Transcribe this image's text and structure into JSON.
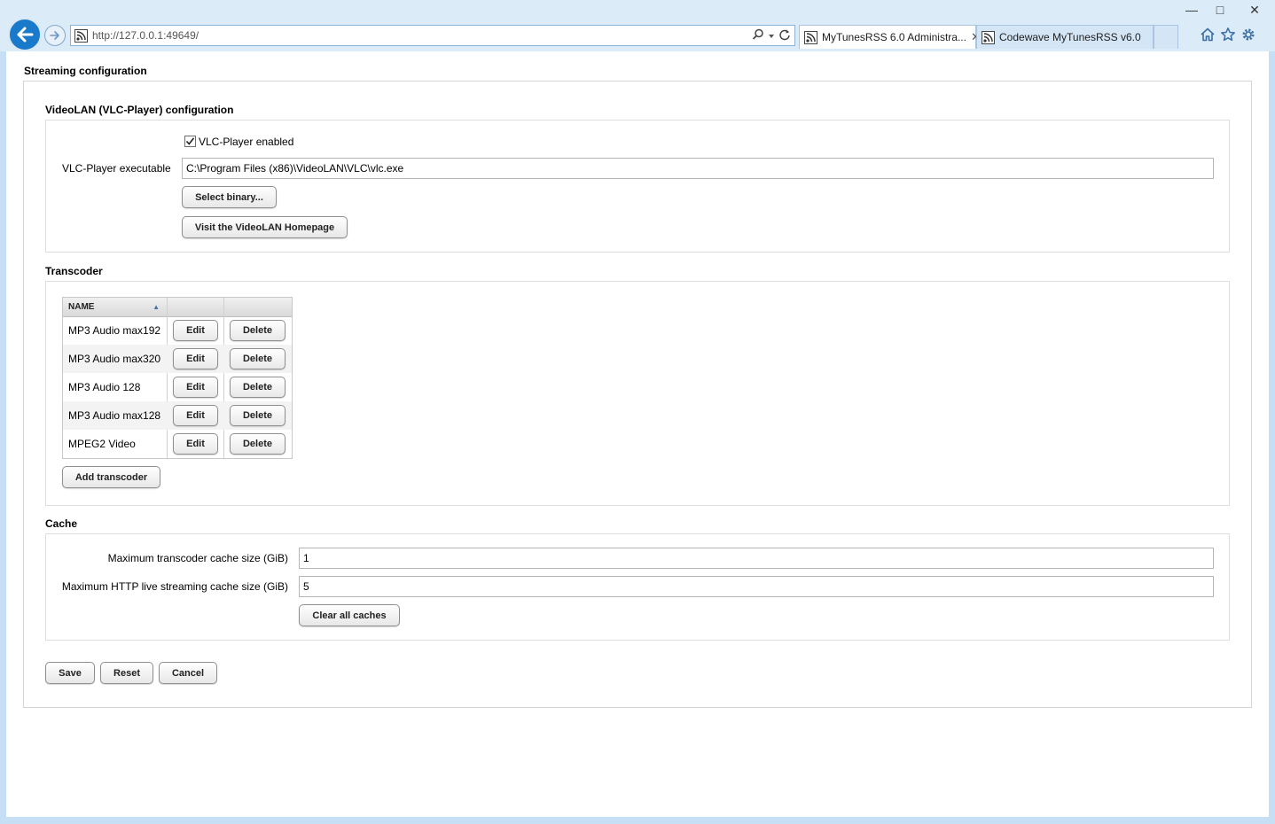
{
  "browser": {
    "url": "http://127.0.0.1:49649/",
    "tabs": [
      {
        "label": "MyTunesRSS 6.0 Administra...",
        "active": true
      },
      {
        "label": "Codewave MyTunesRSS v6.0",
        "active": false
      }
    ],
    "icons": [
      "back-arrow-icon",
      "forward-arrow-icon",
      "rss-favicon-icon",
      "search-icon",
      "dropdown-icon",
      "refresh-icon",
      "close-icon",
      "home-icon",
      "star-icon",
      "gear-icon",
      "minimize-icon",
      "maximize-icon",
      "window-close-icon"
    ]
  },
  "page": {
    "title": "Streaming configuration",
    "vlc": {
      "title": "VideoLAN (VLC-Player) configuration",
      "enabled_label": "VLC-Player enabled",
      "enabled": true,
      "executable_label": "VLC-Player executable",
      "executable_value": "C:\\Program Files (x86)\\VideoLAN\\VLC\\vlc.exe",
      "select_binary_label": "Select binary...",
      "visit_homepage_label": "Visit the VideoLAN Homepage"
    },
    "transcoder": {
      "title": "Transcoder",
      "columns": [
        "NAME",
        "",
        ""
      ],
      "sort_indicator": "▲",
      "rows": [
        {
          "name": "MP3 Audio max192",
          "edit": "Edit",
          "delete": "Delete"
        },
        {
          "name": "MP3 Audio max320",
          "edit": "Edit",
          "delete": "Delete"
        },
        {
          "name": "MP3 Audio 128",
          "edit": "Edit",
          "delete": "Delete"
        },
        {
          "name": "MP3 Audio max128",
          "edit": "Edit",
          "delete": "Delete"
        },
        {
          "name": "MPEG2 Video",
          "edit": "Edit",
          "delete": "Delete"
        }
      ],
      "add_label": "Add transcoder"
    },
    "cache": {
      "title": "Cache",
      "transcoder_cache_label": "Maximum transcoder cache size (GiB)",
      "transcoder_cache_value": "1",
      "hls_cache_label": "Maximum HTTP live streaming cache size (GiB)",
      "hls_cache_value": "5",
      "clear_label": "Clear all caches"
    },
    "actions": {
      "save": "Save",
      "reset": "Reset",
      "cancel": "Cancel"
    }
  },
  "colors": {
    "frame": "#c6dff5",
    "accent": "#1979ca"
  }
}
